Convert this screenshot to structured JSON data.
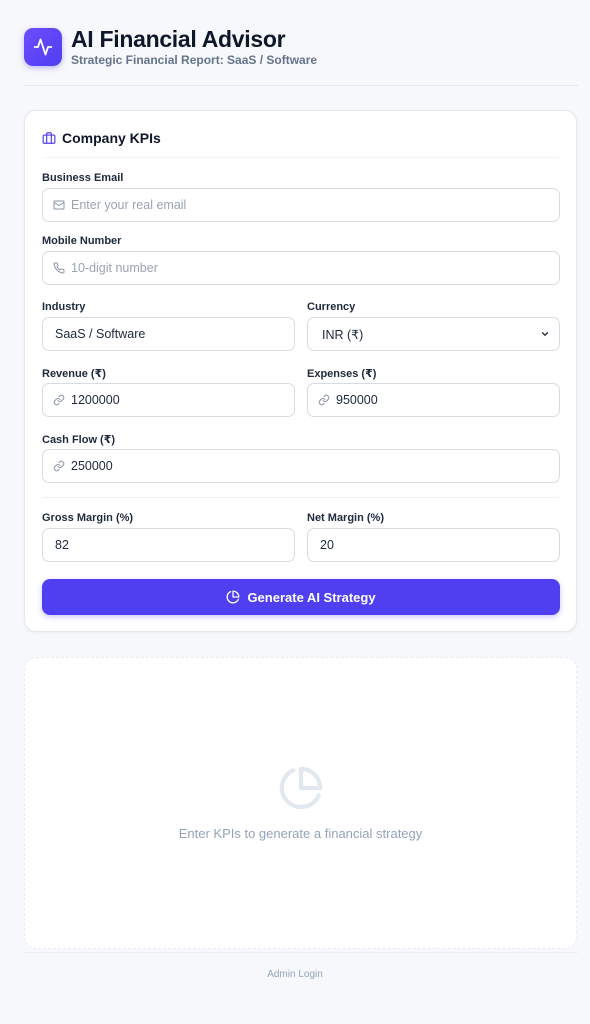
{
  "header": {
    "title": "AI Financial Advisor",
    "subtitle": "Strategic Financial Report: SaaS / Software",
    "logo_icon": "activity-pulse-icon"
  },
  "form": {
    "section_title": "Company KPIs",
    "section_icon": "briefcase-icon",
    "email": {
      "label": "Business Email",
      "placeholder": "Enter your real email",
      "value": "",
      "icon": "mail-icon"
    },
    "mobile": {
      "label": "Mobile Number",
      "placeholder": "10-digit number",
      "value": "",
      "icon": "phone-icon"
    },
    "industry": {
      "label": "Industry",
      "value": "SaaS / Software"
    },
    "currency": {
      "label": "Currency",
      "value": "INR (₹)",
      "icon": "chevron-down-icon"
    },
    "revenue": {
      "label": "Revenue (₹)",
      "value": "1200000",
      "icon": "link-icon"
    },
    "expenses": {
      "label": "Expenses (₹)",
      "value": "950000",
      "icon": "link-icon"
    },
    "cash_flow": {
      "label": "Cash Flow (₹)",
      "value": "250000",
      "icon": "link-icon"
    },
    "gross_margin": {
      "label": "Gross Margin (%)",
      "value": "82"
    },
    "net_margin": {
      "label": "Net Margin (%)",
      "value": "20"
    },
    "submit_label": "Generate AI Strategy",
    "submit_icon": "pie-chart-icon"
  },
  "result": {
    "empty_text": "Enter KPIs to generate a financial strategy",
    "empty_icon": "pie-chart-icon"
  },
  "footer": {
    "admin_link": "Admin Login"
  },
  "colors": {
    "accent": "#4f3ff0",
    "muted": "#94a3b8",
    "border": "#d7dce3"
  }
}
